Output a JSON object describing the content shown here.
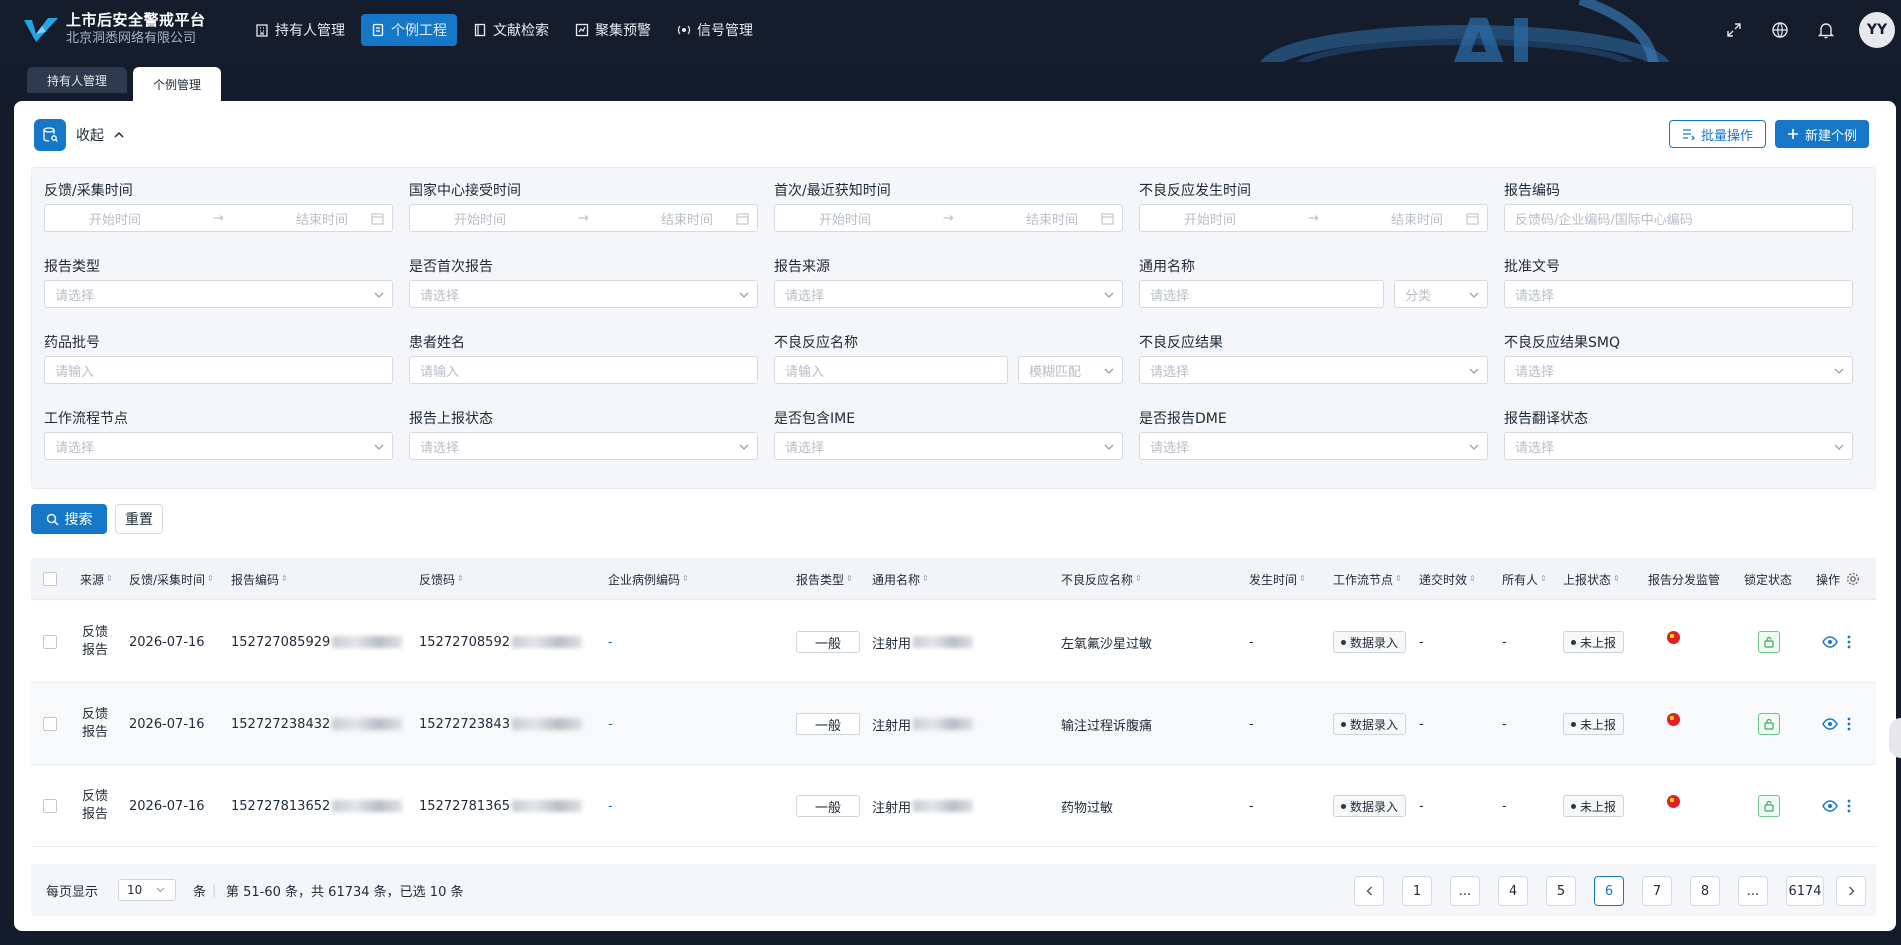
{
  "app": {
    "title": "上市后安全警戒平台",
    "subtitle": "北京洞悉网络有限公司"
  },
  "nav": [
    {
      "label": "持有人管理",
      "icon": "building-icon"
    },
    {
      "label": "个例工程",
      "icon": "document-icon",
      "active": true
    },
    {
      "label": "文献检索",
      "icon": "book-icon"
    },
    {
      "label": "聚集预警",
      "icon": "chart-alert-icon"
    },
    {
      "label": "信号管理",
      "icon": "signal-icon"
    }
  ],
  "header_right": {
    "avatar": "YY"
  },
  "tabs": [
    {
      "label": "持有人管理"
    },
    {
      "label": "个例管理",
      "active": true
    }
  ],
  "panel": {
    "collapse_label": "收起",
    "batch_label": "批量操作",
    "new_label": "新建个例"
  },
  "filters": {
    "f1": {
      "label": "反馈/采集时间",
      "start": "开始时间",
      "end": "结束时间"
    },
    "f2": {
      "label": "国家中心接受时间",
      "start": "开始时间",
      "end": "结束时间"
    },
    "f3": {
      "label": "首次/最近获知时间",
      "start": "开始时间",
      "end": "结束时间"
    },
    "f4": {
      "label": "不良反应发生时间",
      "start": "开始时间",
      "end": "结束时间"
    },
    "f5": {
      "label": "报告编码",
      "placeholder": "反馈码/企业编码/国际中心编码"
    },
    "f6": {
      "label": "报告类型",
      "placeholder": "请选择"
    },
    "f7": {
      "label": "是否首次报告",
      "placeholder": "请选择"
    },
    "f8": {
      "label": "报告来源",
      "placeholder": "请选择"
    },
    "f9": {
      "label": "通用名称",
      "placeholder": "请选择",
      "sub": "分类"
    },
    "f10": {
      "label": "批准文号",
      "placeholder": "请选择"
    },
    "f11": {
      "label": "药品批号",
      "placeholder": "请输入"
    },
    "f12": {
      "label": "患者姓名",
      "placeholder": "请输入"
    },
    "f13": {
      "label": "不良反应名称",
      "placeholder": "请输入",
      "sub": "模糊匹配"
    },
    "f14": {
      "label": "不良反应结果",
      "placeholder": "请选择"
    },
    "f15": {
      "label": "不良反应结果SMQ",
      "placeholder": "请选择"
    },
    "f16": {
      "label": "工作流程节点",
      "placeholder": "请选择"
    },
    "f17": {
      "label": "报告上报状态",
      "placeholder": "请选择"
    },
    "f18": {
      "label": "是否包含IME",
      "placeholder": "请选择"
    },
    "f19": {
      "label": "是否报告DME",
      "placeholder": "请选择"
    },
    "f20": {
      "label": "报告翻译状态",
      "placeholder": "请选择"
    }
  },
  "actions": {
    "search": "搜索",
    "reset": "重置"
  },
  "table": {
    "columns": {
      "source": "来源",
      "date": "反馈/采集时间",
      "code": "报告编码",
      "feedback": "反馈码",
      "corp": "企业病例编码",
      "type": "报告类型",
      "generic": "通用名称",
      "adr": "不良反应名称",
      "occur": "发生时间",
      "workflow": "工作流节点",
      "timeliness": "递交时效",
      "owner": "所有人",
      "status": "上报状态",
      "dist": "报告分发监管",
      "lock": "锁定状态",
      "ops": "操作"
    },
    "rows": [
      {
        "source": "反馈报告",
        "date": "2026-07-16",
        "code": "152727085929",
        "feedback": "15272708592",
        "corp": "-",
        "type": "一般",
        "generic": "注射用",
        "adr": "左氧氟沙星过敏",
        "occur": "-",
        "workflow": "数据录入",
        "timeliness": "-",
        "owner": "-",
        "status": "未上报"
      },
      {
        "source": "反馈报告",
        "date": "2026-07-16",
        "code": "152727238432",
        "feedback": "15272723843",
        "corp": "-",
        "type": "一般",
        "generic": "注射用",
        "adr": "输注过程诉腹痛",
        "occur": "-",
        "workflow": "数据录入",
        "timeliness": "-",
        "owner": "-",
        "status": "未上报"
      },
      {
        "source": "反馈报告",
        "date": "2026-07-16",
        "code": "152727813652",
        "feedback": "15272781365",
        "corp": "-",
        "type": "一般",
        "generic": "注射用",
        "adr": "药物过敏",
        "occur": "-",
        "workflow": "数据录入",
        "timeliness": "-",
        "owner": "-",
        "status": "未上报"
      }
    ]
  },
  "pagination": {
    "per_page_label": "每页显示",
    "per_page": "10",
    "unit": "条",
    "summary": "第 51-60 条，共 61734 条，已选 10 条",
    "pages": [
      "1",
      "...",
      "4",
      "5",
      "6",
      "7",
      "8",
      "...",
      "6174"
    ],
    "current": "6"
  },
  "colors": {
    "primary": "#1677c9",
    "topbar": "#151d2c"
  }
}
